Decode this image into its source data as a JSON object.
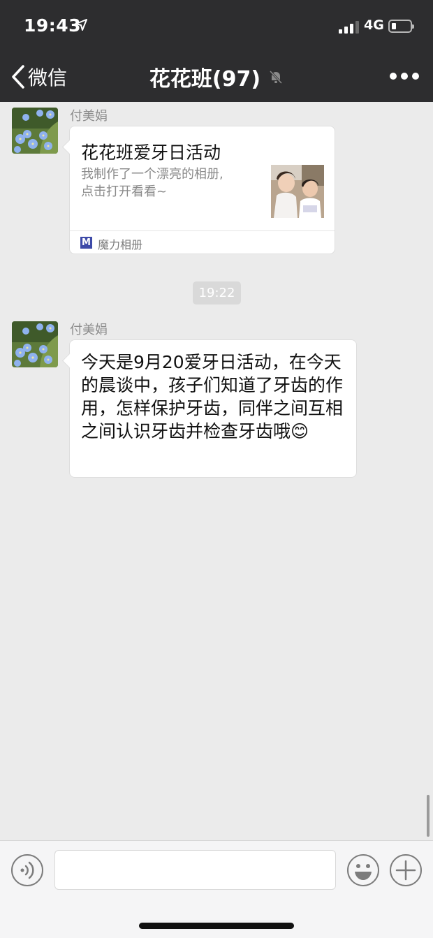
{
  "status_bar": {
    "time": "19:43",
    "network": "4G"
  },
  "nav": {
    "back_label": "微信",
    "title": "花花班(97)"
  },
  "messages": [
    {
      "sender": "付美娟",
      "type": "card",
      "card": {
        "title": "花花班爱牙日活动",
        "desc_line1": "我制作了一个漂亮的相册,",
        "desc_line2": "点击打开看看~",
        "app_logo": "M",
        "app_name": "魔力相册"
      }
    },
    {
      "type": "time",
      "text": "19:22"
    },
    {
      "sender": "付美娟",
      "type": "text",
      "text": "今天是9月20爱牙日活动，在今天的晨谈中，孩子们知道了牙齿的作用，怎样保护牙齿，同伴之间互相之间认识牙齿并检查牙齿哦😊"
    }
  ],
  "input_bar": {
    "text_value": ""
  },
  "icons": {
    "back": "chevron-left-icon",
    "mute": "bell-slash-icon",
    "more": "ellipsis-icon",
    "voice": "voice-icon",
    "emoji": "smiley-icon",
    "add": "plus-icon"
  },
  "colors": {
    "nav_bg": "#2d2d2f",
    "chat_bg": "#ebebeb",
    "app_logo": "#3d4aa8"
  }
}
